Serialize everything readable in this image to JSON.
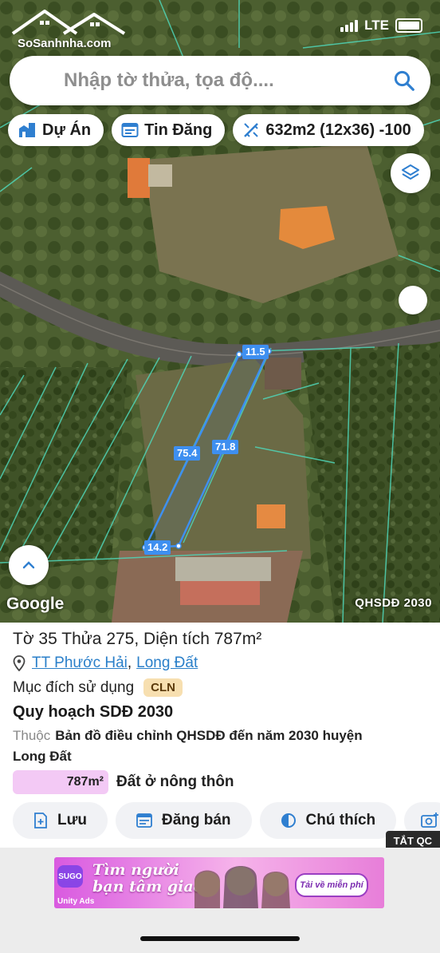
{
  "status": {
    "network": "LTE"
  },
  "logo": {
    "text": "SoSanhnha.com"
  },
  "search": {
    "placeholder": "Nhập tờ thửa, tọa độ...."
  },
  "chips": {
    "project": "Dự Án",
    "listing": "Tin Đăng",
    "measure": "632m2 (12x36) -100"
  },
  "map": {
    "dimensions": [
      "11.5",
      "75.4",
      "71.8",
      "14.2"
    ],
    "attribution": "Google",
    "layer_label": "QHSDĐ 2030",
    "accent": "#3e8ff0"
  },
  "parcel": {
    "title": "Tờ 35 Thửa 275, Diện tích 787m²",
    "location": {
      "ward": "TT Phước Hải",
      "separator": ",",
      "district": "Long Đất"
    },
    "purpose_label": "Mục đích sử dụng",
    "purpose_code": "CLN",
    "plan_title": "Quy hoạch SDĐ 2030",
    "belong_prefix": "Thuộc",
    "belong_text": "Bản đồ điều chỉnh QHSDĐ đến năm 2030 huyện Long Đất",
    "area_value": "787m²",
    "area_type": "Đất ở nông thôn",
    "area_color": "#f3c9f5"
  },
  "actions": {
    "save": "Lưu",
    "post": "Đăng bán",
    "legend": "Chú thích"
  },
  "ad": {
    "close_label": "TẮT QC",
    "brand": "SUGO",
    "headline_1": "Tìm người",
    "headline_2": "bạn tâm giao",
    "cta": "Tải về miễn phí",
    "network": "Unity Ads"
  }
}
